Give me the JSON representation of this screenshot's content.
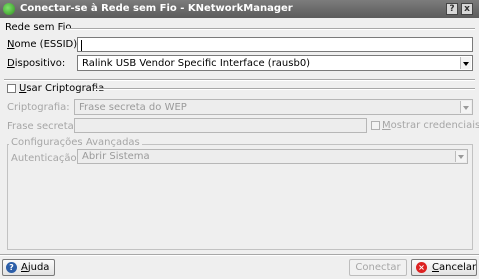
{
  "window": {
    "title": "Conectar-se à Rede sem Fio - KNetworkManager",
    "help_button": "?",
    "close_button": "x"
  },
  "wireless": {
    "group_title": "Rede sem Fio",
    "essid_label_mnemonic": "N",
    "essid_label_rest": "ome (ESSID):",
    "essid_value": "",
    "device_label_mnemonic": "D",
    "device_label_rest": "ispositivo:",
    "device_value": "Ralink USB Vendor Specific Interface (rausb0)"
  },
  "encryption": {
    "use_label_mnemonic": "U",
    "use_label_rest": "sar Criptografia",
    "use_checked": false,
    "type_label": "Criptografia:",
    "type_value": "Frase secreta do WEP",
    "passphrase_label": "Frase secreta:",
    "passphrase_value": "",
    "show_label_mnemonic": "M",
    "show_label_rest": "ostrar credenciais",
    "show_checked": false
  },
  "advanced": {
    "frame_title": "Configurações Avançadas",
    "auth_label": "Autenticação:",
    "auth_value": "Abrir Sistema"
  },
  "footer": {
    "help_mnemonic": "A",
    "help_rest": "juda",
    "connect_label": "Conectar",
    "cancel_mnemonic": "C",
    "cancel_rest": "ancelar"
  }
}
